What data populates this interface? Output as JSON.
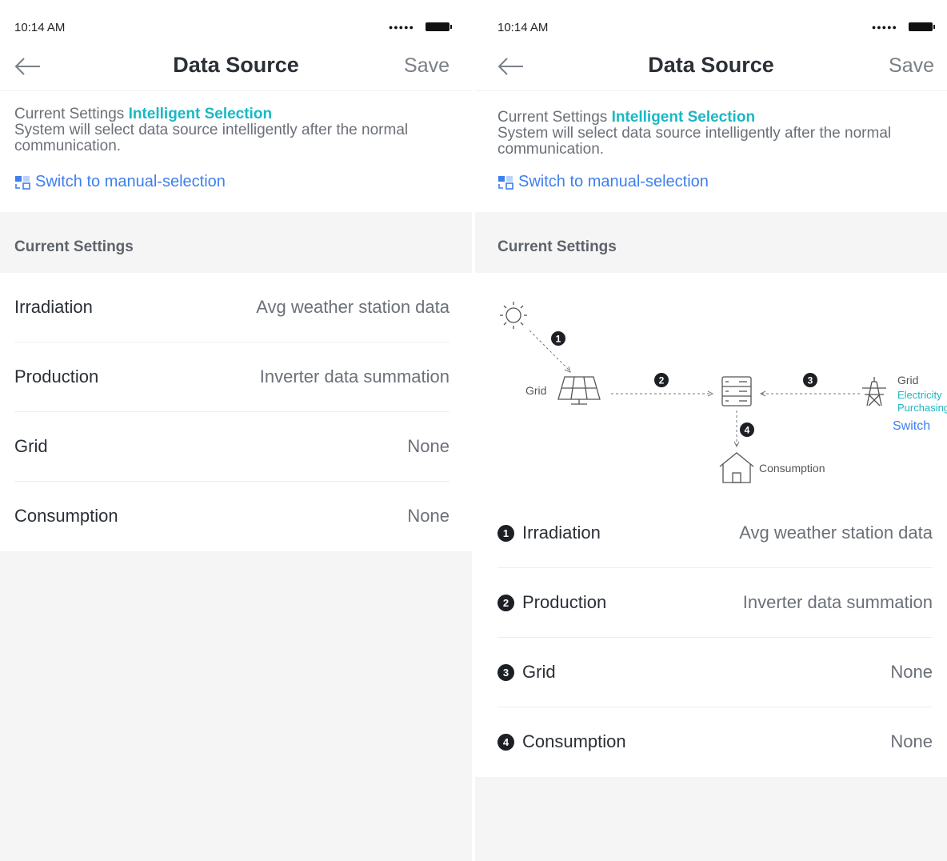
{
  "status": {
    "time": "10:14 AM",
    "signal": "●●●●●"
  },
  "nav": {
    "title": "Data Source",
    "save_label": "Save"
  },
  "info": {
    "prefix": "Current Settings",
    "mode": "Intelligent Selection",
    "description": "System will select data source intelligently after the normal communication.",
    "switch_label": "Switch to manual-selection"
  },
  "section_title": "Current Settings",
  "left_rows": [
    {
      "label": "Irradiation",
      "value": "Avg weather station data"
    },
    {
      "label": "Production",
      "value": "Inverter data summation"
    },
    {
      "label": "Grid",
      "value": "None"
    },
    {
      "label": "Consumption",
      "value": "None"
    }
  ],
  "diagram": {
    "grid_left_label": "Grid",
    "grid_right_label": "Grid",
    "electricity_label_1": "Electricity",
    "electricity_label_2": "Purchasing",
    "switch_label": "Switch",
    "consumption_label": "Consumption",
    "badges": [
      "1",
      "2",
      "3",
      "4"
    ]
  },
  "right_rows": [
    {
      "badge": "1",
      "label": "Irradiation",
      "value": "Avg weather station data"
    },
    {
      "badge": "2",
      "label": "Production",
      "value": "Inverter data summation"
    },
    {
      "badge": "3",
      "label": "Grid",
      "value": "None"
    },
    {
      "badge": "4",
      "label": "Consumption",
      "value": "None"
    }
  ],
  "colors": {
    "accent": "#19b8c4",
    "link": "#3d7ff0",
    "background": "#f5f5f5"
  }
}
